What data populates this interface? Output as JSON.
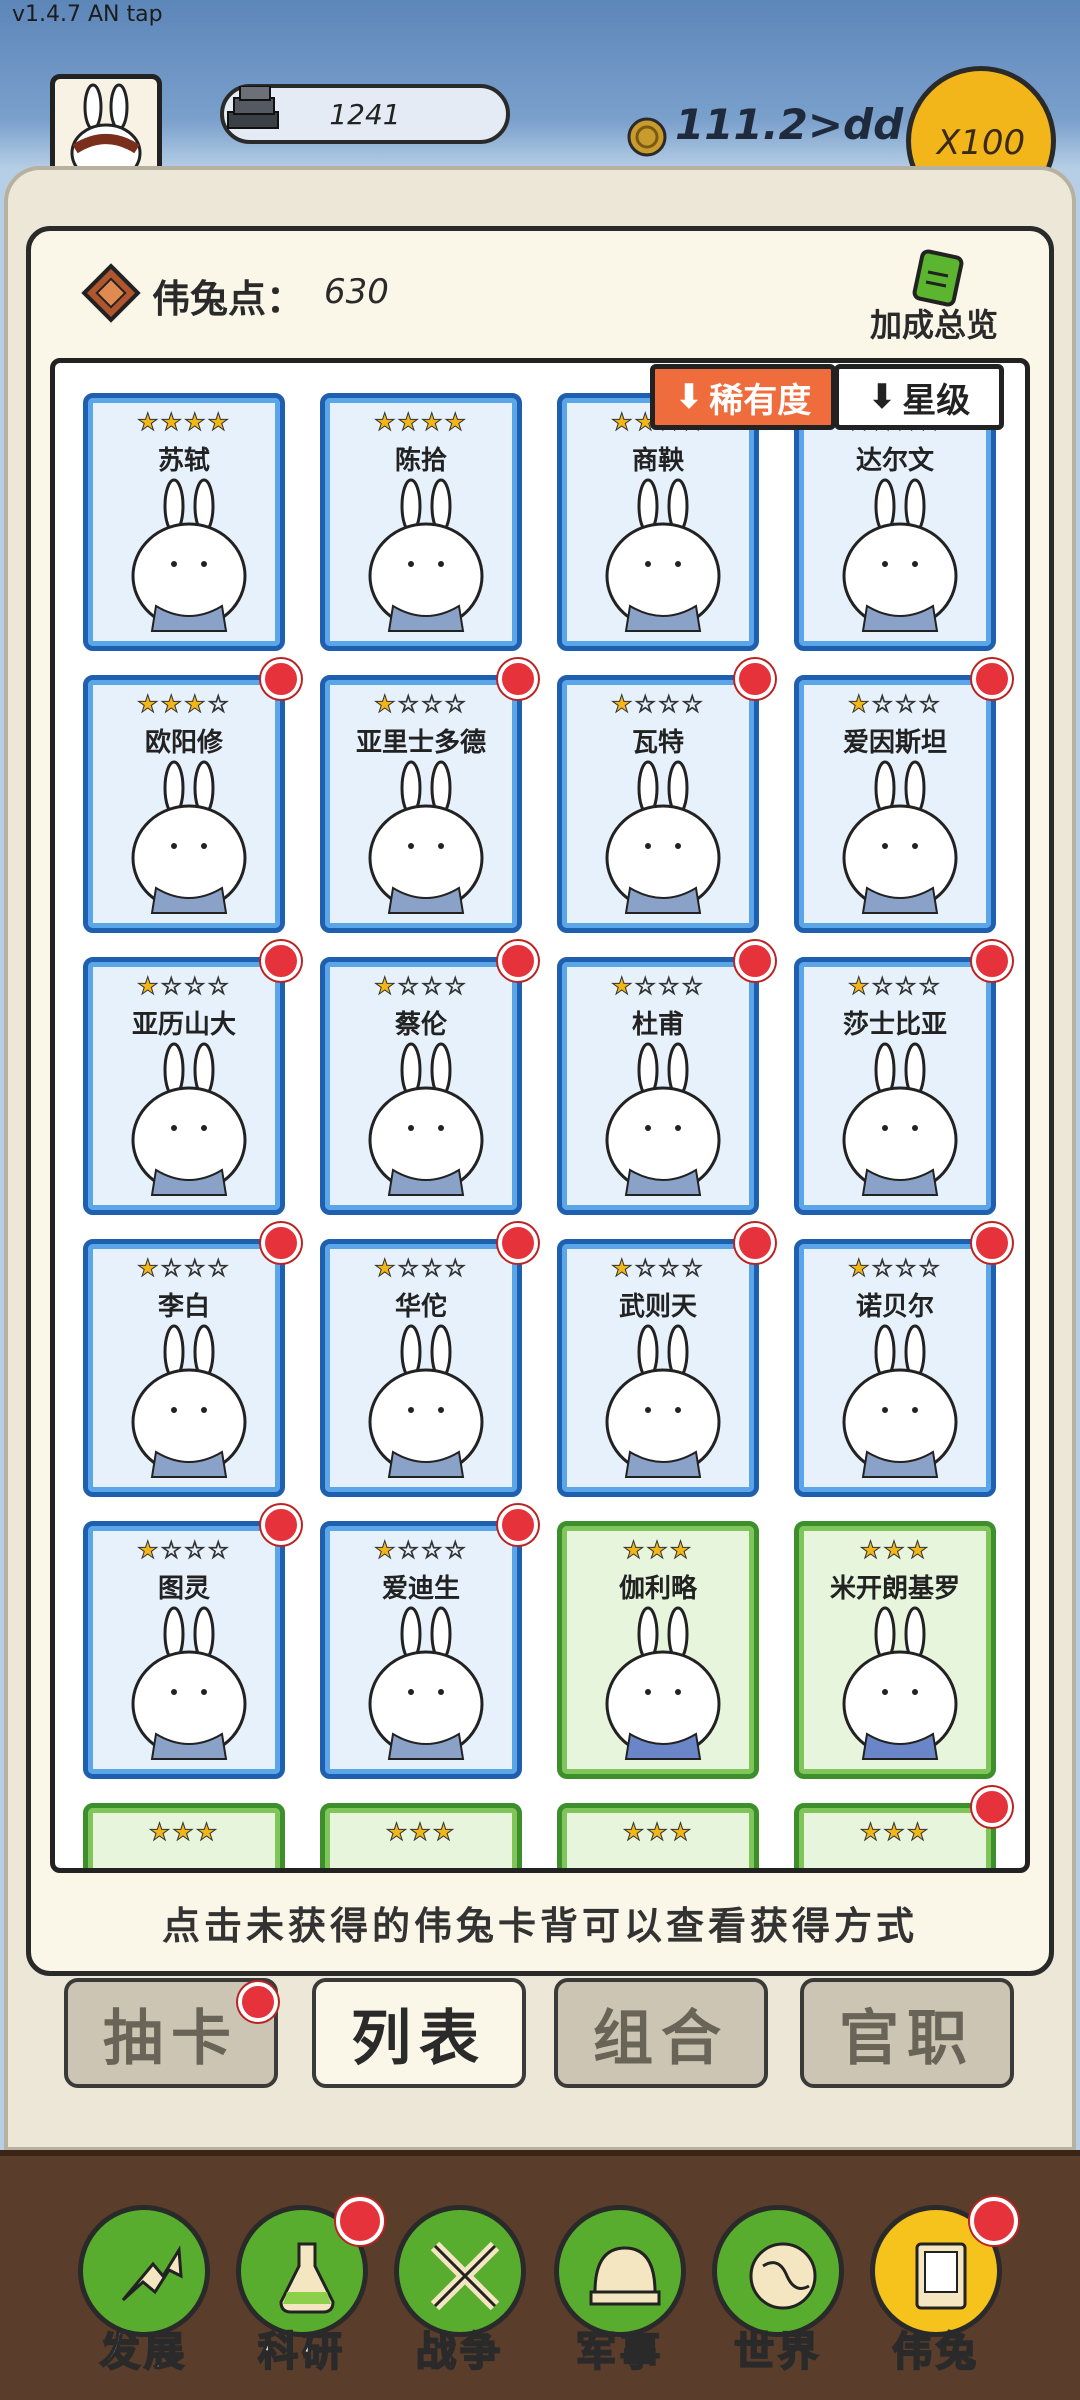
{
  "version": "v1.4.7 AN tap",
  "hud": {
    "bars_value": "1241",
    "gold_value": "111.2>dd",
    "multiplier": "X100"
  },
  "header": {
    "points_label": "伟兔点：",
    "points_value": "630",
    "bonus_label": "加成总览"
  },
  "sort": {
    "rarity": "稀有度",
    "star": "星级"
  },
  "cards": [
    {
      "name": "苏轼",
      "stars": "★★★★",
      "color": "blue",
      "dot": false
    },
    {
      "name": "陈拾",
      "stars": "★★★★",
      "color": "blue",
      "dot": false
    },
    {
      "name": "商鞅",
      "stars": "★★★★",
      "color": "blue",
      "dot": false
    },
    {
      "name": "达尔文",
      "stars": "★★★★",
      "color": "blue",
      "dot": false
    },
    {
      "name": "欧阳修",
      "stars": "★★★☆",
      "color": "blue",
      "dot": true
    },
    {
      "name": "亚里士多德",
      "stars": "★☆☆☆",
      "color": "blue",
      "dot": true
    },
    {
      "name": "瓦特",
      "stars": "★☆☆☆",
      "color": "blue",
      "dot": true
    },
    {
      "name": "爱因斯坦",
      "stars": "★☆☆☆",
      "color": "blue",
      "dot": true
    },
    {
      "name": "亚历山大",
      "stars": "★☆☆☆",
      "color": "blue",
      "dot": true
    },
    {
      "name": "蔡伦",
      "stars": "★☆☆☆",
      "color": "blue",
      "dot": true
    },
    {
      "name": "杜甫",
      "stars": "★☆☆☆",
      "color": "blue",
      "dot": true
    },
    {
      "name": "莎士比亚",
      "stars": "★☆☆☆",
      "color": "blue",
      "dot": true
    },
    {
      "name": "李白",
      "stars": "★☆☆☆",
      "color": "blue",
      "dot": true
    },
    {
      "name": "华佗",
      "stars": "★☆☆☆",
      "color": "blue",
      "dot": true
    },
    {
      "name": "武则天",
      "stars": "★☆☆☆",
      "color": "blue",
      "dot": true
    },
    {
      "name": "诺贝尔",
      "stars": "★☆☆☆",
      "color": "blue",
      "dot": true
    },
    {
      "name": "图灵",
      "stars": "★☆☆☆",
      "color": "blue",
      "dot": true
    },
    {
      "name": "爱迪生",
      "stars": "★☆☆☆",
      "color": "blue",
      "dot": true
    },
    {
      "name": "伽利略",
      "stars": "★★★",
      "color": "green",
      "dot": false
    },
    {
      "name": "米开朗基罗",
      "stars": "★★★",
      "color": "green",
      "dot": false
    },
    {
      "name": "",
      "stars": "★★★",
      "color": "green",
      "dot": false
    },
    {
      "name": "",
      "stars": "★★★",
      "color": "green",
      "dot": false
    },
    {
      "name": "",
      "stars": "★★★",
      "color": "green",
      "dot": false
    },
    {
      "name": "",
      "stars": "★★★",
      "color": "green",
      "dot": true
    }
  ],
  "hint": "点击未获得的伟兔卡背可以查看获得方式",
  "tabs": [
    {
      "label": "抽卡",
      "active": false,
      "dot": true
    },
    {
      "label": "列表",
      "active": true,
      "dot": false
    },
    {
      "label": "组合",
      "active": false,
      "dot": false
    },
    {
      "label": "官职",
      "active": false,
      "dot": false
    }
  ],
  "nav": [
    {
      "label": "发展",
      "icon": "arrow-up-icon",
      "dot": false,
      "active": false
    },
    {
      "label": "科研",
      "icon": "flask-icon",
      "dot": true,
      "active": false
    },
    {
      "label": "战争",
      "icon": "crossed-swords-icon",
      "dot": false,
      "active": false
    },
    {
      "label": "军事",
      "icon": "helmet-icon",
      "dot": false,
      "active": false
    },
    {
      "label": "世界",
      "icon": "globe-icon",
      "dot": false,
      "active": false
    },
    {
      "label": "伟兔",
      "icon": "card-icon",
      "dot": true,
      "active": true
    }
  ]
}
